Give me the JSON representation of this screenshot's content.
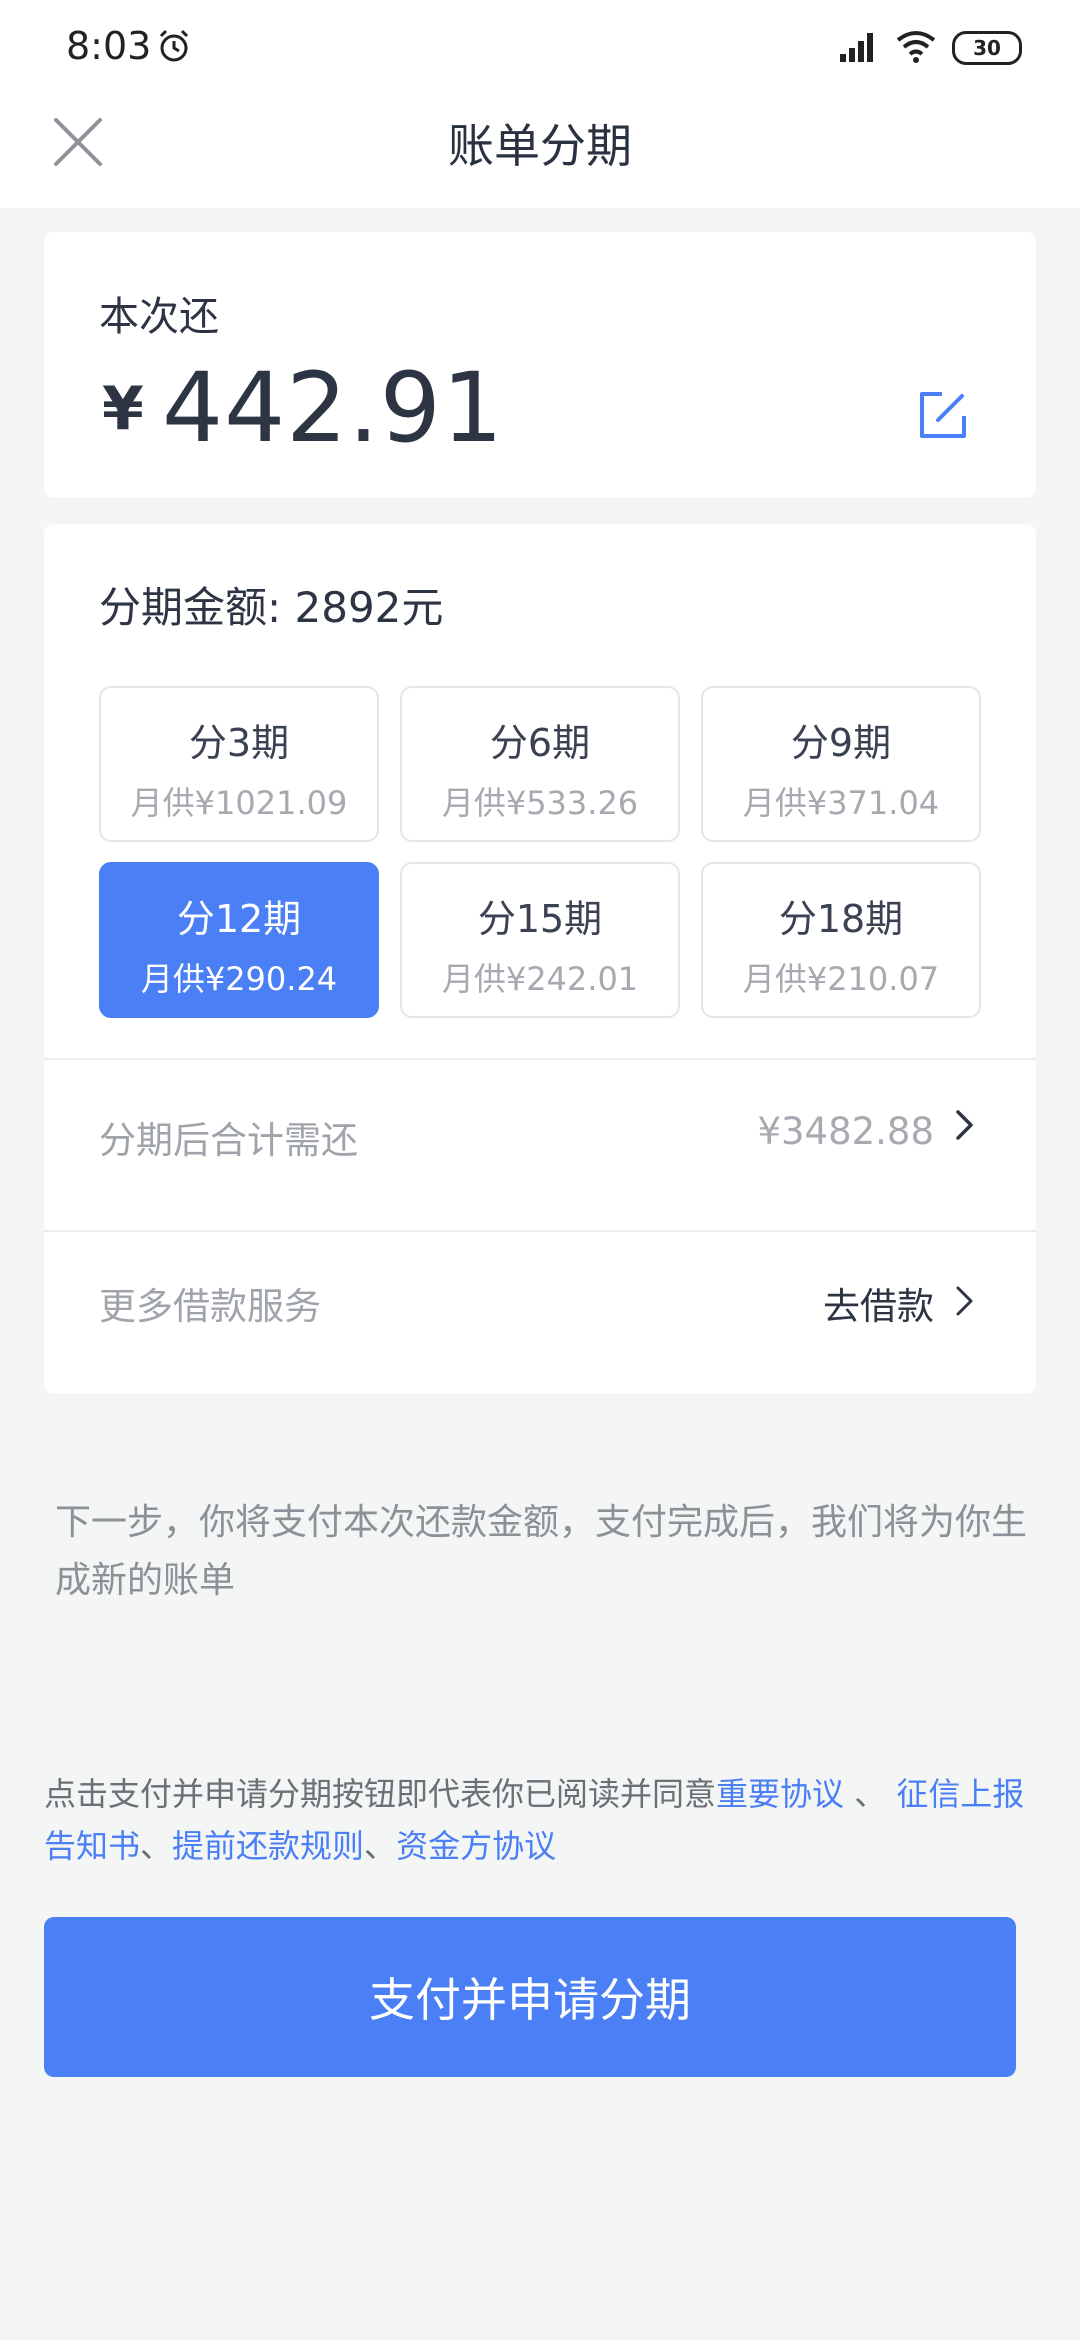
{
  "status_bar": {
    "time": "8:03",
    "battery": "30",
    "icons": [
      "alarm-icon",
      "signal-icon",
      "wifi-icon",
      "battery-icon"
    ]
  },
  "header": {
    "title": "账单分期",
    "close_icon": "close-icon"
  },
  "repayment": {
    "label": "本次还",
    "currency": "¥",
    "amount": "442.91",
    "edit_icon": "edit-icon"
  },
  "installment": {
    "total_label": "分期金额: 2892元",
    "options": [
      {
        "period": "分3期",
        "monthly": "月供¥1021.09",
        "selected": false
      },
      {
        "period": "分6期",
        "monthly": "月供¥533.26",
        "selected": false
      },
      {
        "period": "分9期",
        "monthly": "月供¥371.04",
        "selected": false
      },
      {
        "period": "分12期",
        "monthly": "月供¥290.24",
        "selected": true
      },
      {
        "period": "分15期",
        "monthly": "月供¥242.01",
        "selected": false
      },
      {
        "period": "分18期",
        "monthly": "月供¥210.07",
        "selected": false
      }
    ],
    "total_after": {
      "label": "分期后合计需还",
      "value": "¥3482.88"
    },
    "more_services": {
      "label": "更多借款服务",
      "action": "去借款"
    }
  },
  "notice": "下一步，你将支付本次还款金额，支付完成后，我们将为你生成新的账单",
  "agreement": {
    "prefix": "点击支付并申请分期按钮即代表你已阅读并同意",
    "link1": "重要协议",
    "sep1": " 、",
    "link2": "征信上报告知书",
    "sep2": "、",
    "link3": "提前还款规则",
    "sep3": "、",
    "link4": "资金方协议"
  },
  "submit_label": "支付并申请分期",
  "colors": {
    "accent": "#4a7ff5",
    "background": "#f4f5f5",
    "text_dark": "#2d3443",
    "text_muted": "#9fa3aa"
  }
}
